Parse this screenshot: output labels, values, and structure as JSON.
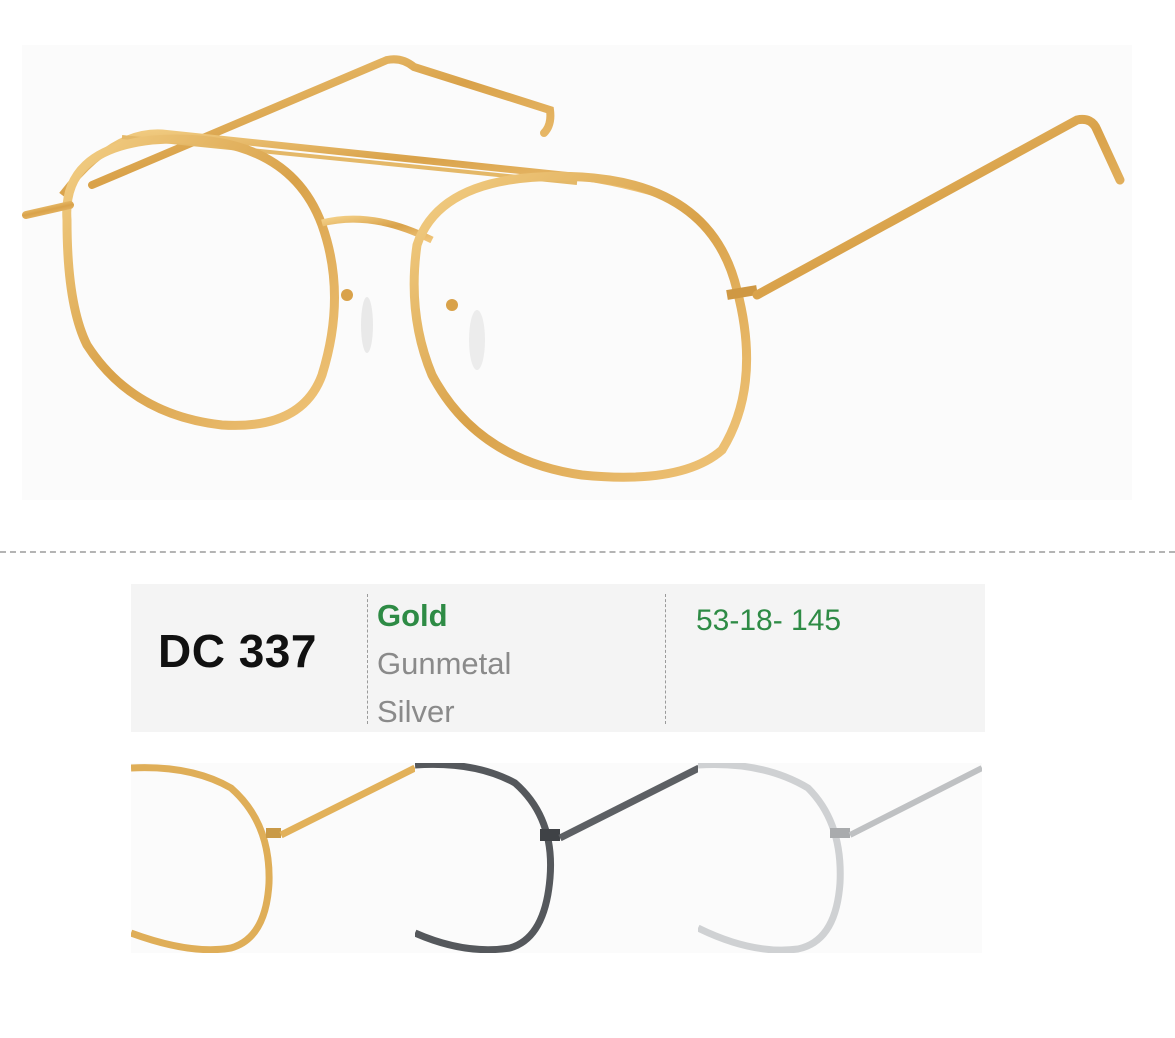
{
  "product": {
    "model_code": "DC 337",
    "size": "53-18- 145"
  },
  "colors": [
    {
      "label": "Gold",
      "selected": true
    },
    {
      "label": "Gunmetal",
      "selected": false
    },
    {
      "label": "Silver",
      "selected": false
    }
  ],
  "palette": {
    "accent_green": "#2e8b45",
    "gold": "#e2b15a",
    "gunmetal": "#55585c",
    "silver": "#c9cbcd"
  },
  "images": {
    "hero": "gold aviator eyeglasses frame",
    "swatches": [
      "gold-frame-swatch",
      "gunmetal-frame-swatch",
      "silver-frame-swatch"
    ]
  }
}
